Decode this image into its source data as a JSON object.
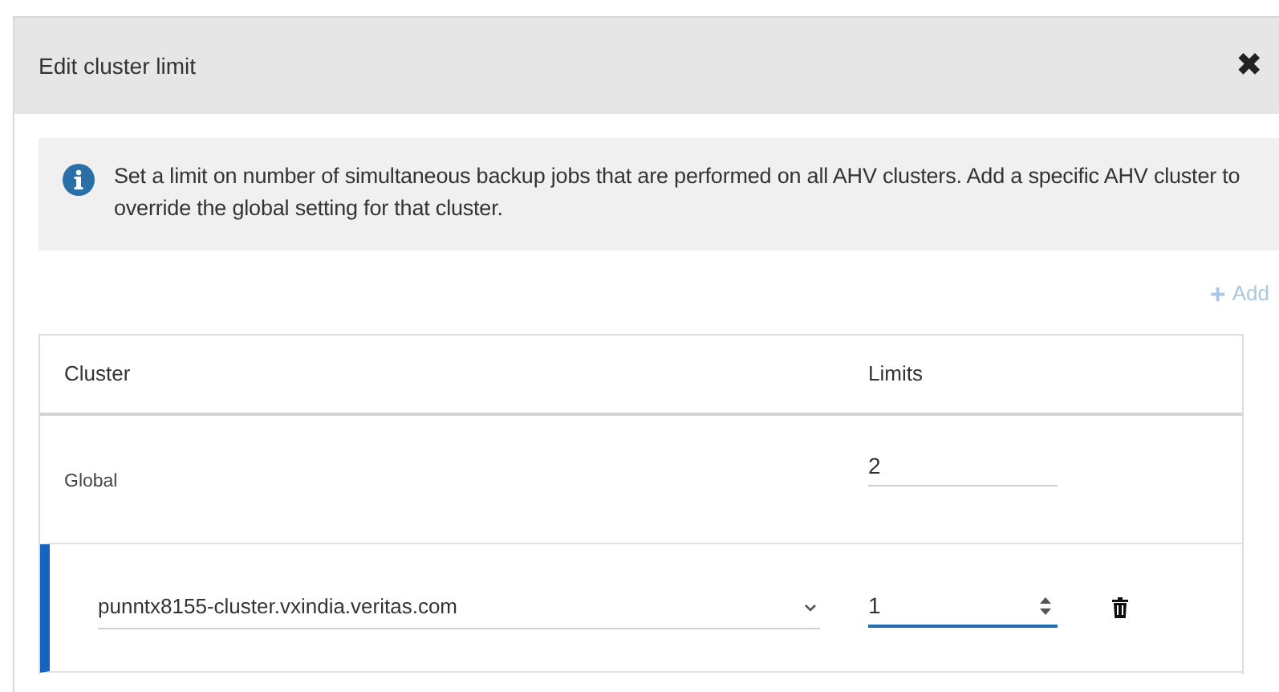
{
  "dialog": {
    "title": "Edit cluster limit",
    "close": "✖"
  },
  "info": {
    "text": "Set a limit on number of simultaneous backup jobs that are performed on all AHV clusters. Add a specific AHV cluster to override the global setting for that cluster."
  },
  "add_button": {
    "icon": "+",
    "label": "Add",
    "disabled": true
  },
  "table": {
    "columns": [
      "Cluster",
      "Limits"
    ],
    "rows": [
      {
        "kind": "global",
        "cluster": "Global",
        "limit": "2",
        "selected": false
      },
      {
        "kind": "cluster",
        "cluster": "punntx8155-cluster.vxindia.veritas.com",
        "limit": "1",
        "selected": true
      }
    ]
  }
}
